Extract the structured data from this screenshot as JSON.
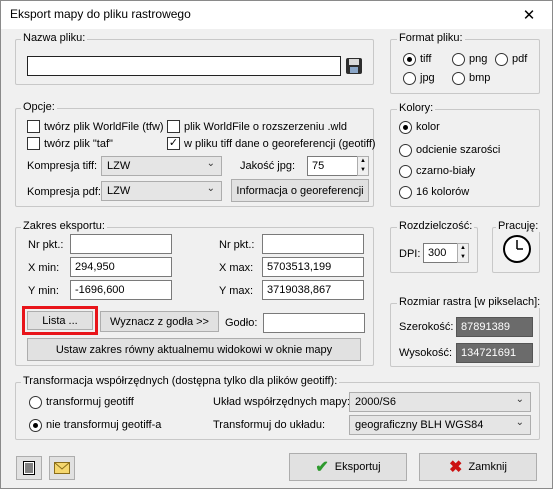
{
  "window": {
    "title": "Eksport mapy do pliku rastrowego",
    "close_glyph": "✕"
  },
  "file": {
    "legend": "Nazwa pliku:",
    "value": ""
  },
  "format": {
    "legend": "Format pliku:",
    "options": [
      "tiff",
      "png",
      "pdf",
      "jpg",
      "bmp"
    ],
    "selected": "tiff"
  },
  "options": {
    "legend": "Opcje:",
    "chk_worldfile": "twórz plik WorldFile (tfw)",
    "chk_taf": "twórz plik \"taf\"",
    "chk_wld": "plik WorldFile o rozszerzeniu .wld",
    "chk_geotiff": "w pliku tiff dane o georeferencji (geotiff)",
    "tiff_comp_label": "Kompresja tiff:",
    "tiff_comp_value": "LZW",
    "pdf_comp_label": "Kompresja pdf:",
    "pdf_comp_value": "LZW",
    "jpg_quality_label": "Jakość jpg:",
    "jpg_quality_value": "75",
    "georef_info_button": "Informacja o georeferencji"
  },
  "colors": {
    "legend": "Kolory:",
    "options": [
      "kolor",
      "odcienie szarości",
      "czarno-biały",
      "16 kolorów"
    ],
    "selected": "kolor"
  },
  "extent": {
    "legend": "Zakres eksportu:",
    "nr_label_left": "Nr pkt.:",
    "nr_value_left": "",
    "nr_label_right": "Nr pkt.:",
    "nr_value_right": "",
    "xmin_label": "X min:",
    "xmin_value": "294,950",
    "xmax_label": "X max:",
    "xmax_value": "5703513,199",
    "ymin_label": "Y min:",
    "ymin_value": "-1696,600",
    "ymax_label": "Y max:",
    "ymax_value": "3719038,867",
    "list_button": "Lista ...",
    "godlo_button": "Wyznacz z godła >>",
    "godlo_label": "Godło:",
    "godlo_value": "",
    "current_view_button": "Ustaw zakres równy aktualnemu widokowi w oknie mapy"
  },
  "resolution": {
    "legend": "Rozdzielczość:",
    "dpi_label": "DPI:",
    "dpi_value": "300"
  },
  "working": {
    "legend": "Pracuję:"
  },
  "raster_size": {
    "legend": "Rozmiar rastra [w pikselach]:",
    "width_label": "Szerokość:",
    "width_value": "87891389",
    "height_label": "Wysokość:",
    "height_value": "134721691"
  },
  "transform": {
    "legend": "Transformacja współrzędnych (dostępna tylko dla plików geotiff):",
    "radio_transform": "transformuj geotiff",
    "radio_no_transform": "nie transformuj geotiff-a",
    "selected": "nie transformuj geotiff-a",
    "map_cs_label": "Układ współrzędnych mapy:",
    "map_cs_value": "2000/S6",
    "target_cs_label": "Transformuj do układu:",
    "target_cs_value": "geograficzny BLH WGS84"
  },
  "footer": {
    "export_button": "Eksportuj",
    "close_button": "Zamknij"
  },
  "accent": {
    "highlight": "#e8141a",
    "check_green": "#2e9a2e",
    "close_red": "#cc1111",
    "disabled_field": "#6b6b6b"
  }
}
